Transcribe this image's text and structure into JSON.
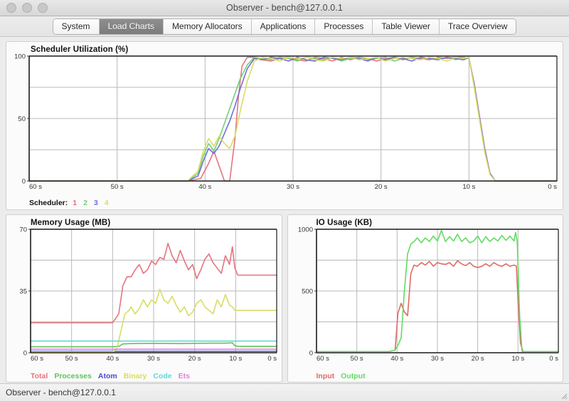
{
  "window": {
    "title": "Observer - bench@127.0.0.1",
    "traffic_lights": [
      "close-button",
      "minimize-button",
      "zoom-button"
    ]
  },
  "tabs": [
    {
      "label": "System",
      "active": false
    },
    {
      "label": "Load Charts",
      "active": true
    },
    {
      "label": "Memory Allocators",
      "active": false
    },
    {
      "label": "Applications",
      "active": false
    },
    {
      "label": "Processes",
      "active": false
    },
    {
      "label": "Table Viewer",
      "active": false
    },
    {
      "label": "Trace Overview",
      "active": false
    }
  ],
  "statusbar": {
    "text": "Observer - bench@127.0.0.1"
  },
  "chart_data": [
    {
      "id": "scheduler",
      "type": "line",
      "title": "Scheduler Utilization (%)",
      "xlabel": "",
      "ylabel": "",
      "ylim": [
        0,
        100
      ],
      "yticks": [
        0,
        50,
        100
      ],
      "ytick_labels": [
        "0",
        "50",
        "100"
      ],
      "xticks": [
        60,
        50,
        40,
        30,
        20,
        10,
        0
      ],
      "xtick_labels": [
        "60 s",
        "50 s",
        "40 s",
        "30 s",
        "20 s",
        "10 s",
        "0 s"
      ],
      "xlim": [
        60,
        0
      ],
      "grid": true,
      "legend_label": "Scheduler:",
      "legend_position": "bottom-left",
      "series": [
        {
          "name": "1",
          "color": "#e8737d",
          "x": [
            60,
            48,
            42,
            40.5,
            39.6,
            39.0,
            38.4,
            37.8,
            37.2,
            36.6,
            36.2,
            35.8,
            35.2,
            34.4,
            33.5,
            32.5,
            31.5,
            30.5,
            29.5,
            28.5,
            27.5,
            26.5,
            25.5,
            24.5,
            23.5,
            22.5,
            21.5,
            20.5,
            19.5,
            18.5,
            17.5,
            16.5,
            15.5,
            14.5,
            13.5,
            12.5,
            11.5,
            10.6,
            10.0,
            9.4,
            8.8,
            8.2,
            7.6,
            7.0,
            4.0,
            0
          ],
          "values": [
            0,
            0,
            0,
            2,
            14,
            24,
            12,
            0,
            0,
            34,
            68,
            92,
            99,
            99,
            97,
            96,
            98,
            99,
            97,
            96,
            99,
            98,
            96,
            99,
            97,
            99,
            98,
            96,
            98,
            99,
            97,
            99,
            98,
            97,
            99,
            98,
            99,
            99,
            98,
            78,
            52,
            26,
            6,
            0,
            0,
            0
          ]
        },
        {
          "name": "2",
          "color": "#74d072",
          "x": [
            60,
            48,
            42,
            40.8,
            40.2,
            39.6,
            39.0,
            38.4,
            37.8,
            37.2,
            36.6,
            36.0,
            35.2,
            34.4,
            33.5,
            32.5,
            31.5,
            30.5,
            29.5,
            28.5,
            27.5,
            26.5,
            25.5,
            24.5,
            23.5,
            22.5,
            21.5,
            20.5,
            19.5,
            18.5,
            17.5,
            16.5,
            15.5,
            14.5,
            13.5,
            12.5,
            11.5,
            10.6,
            10.0,
            9.4,
            8.8,
            8.2,
            7.6,
            7.0,
            4.0,
            0
          ],
          "values": [
            0,
            0,
            0,
            6,
            20,
            30,
            24,
            34,
            46,
            58,
            70,
            82,
            93,
            99,
            98,
            97,
            99,
            98,
            96,
            99,
            98,
            97,
            99,
            96,
            98,
            99,
            97,
            98,
            99,
            96,
            98,
            99,
            97,
            99,
            98,
            99,
            97,
            99,
            98,
            76,
            50,
            24,
            6,
            0,
            0,
            0
          ]
        },
        {
          "name": "3",
          "color": "#6f6fd8",
          "x": [
            60,
            48,
            42,
            40.8,
            40.2,
            39.6,
            39.0,
            38.4,
            37.8,
            37.2,
            36.6,
            36.0,
            35.2,
            34.4,
            33.5,
            32.5,
            31.5,
            30.5,
            29.5,
            28.5,
            27.5,
            26.5,
            25.5,
            24.5,
            23.5,
            22.5,
            21.5,
            20.5,
            19.5,
            18.5,
            17.5,
            16.5,
            15.5,
            14.5,
            13.5,
            12.5,
            11.5,
            10.6,
            10.0,
            9.4,
            8.8,
            8.2,
            7.6,
            7.0,
            4.0,
            0
          ],
          "values": [
            0,
            0,
            0,
            4,
            16,
            26,
            22,
            28,
            38,
            48,
            60,
            74,
            90,
            98,
            97,
            99,
            98,
            96,
            99,
            97,
            96,
            99,
            98,
            97,
            99,
            98,
            96,
            99,
            97,
            99,
            98,
            96,
            99,
            98,
            97,
            99,
            98,
            97,
            99,
            77,
            51,
            25,
            6,
            0,
            0,
            0
          ]
        },
        {
          "name": "4",
          "color": "#d9dc63",
          "x": [
            60,
            48,
            42,
            40.8,
            40.2,
            39.6,
            39.0,
            38.4,
            37.8,
            37.2,
            36.6,
            36.0,
            35.2,
            34.4,
            33.5,
            32.5,
            31.5,
            30.5,
            29.5,
            28.5,
            27.5,
            26.5,
            25.5,
            24.5,
            23.5,
            22.5,
            21.5,
            20.5,
            19.5,
            18.5,
            17.5,
            16.5,
            15.5,
            14.5,
            13.5,
            12.5,
            11.5,
            10.6,
            10.0,
            9.4,
            8.8,
            8.2,
            7.6,
            7.0,
            4.0,
            0
          ],
          "values": [
            0,
            0,
            0,
            8,
            24,
            34,
            28,
            36,
            30,
            26,
            36,
            56,
            80,
            96,
            99,
            98,
            96,
            99,
            98,
            99,
            97,
            96,
            99,
            98,
            99,
            97,
            98,
            99,
            96,
            98,
            99,
            98,
            97,
            99,
            98,
            96,
            99,
            98,
            99,
            75,
            49,
            23,
            5,
            0,
            0,
            0
          ]
        }
      ]
    },
    {
      "id": "memory",
      "type": "line",
      "title": "Memory Usage (MB)",
      "ylim": [
        0,
        70
      ],
      "yticks": [
        0,
        35,
        70
      ],
      "ytick_labels": [
        "0",
        "35",
        "70"
      ],
      "xticks": [
        60,
        50,
        40,
        30,
        20,
        10,
        0
      ],
      "xtick_labels": [
        "60 s",
        "50 s",
        "40 s",
        "30 s",
        "20 s",
        "10 s",
        "0 s"
      ],
      "xlim": [
        60,
        0
      ],
      "grid": true,
      "legend_position": "bottom-left",
      "series": [
        {
          "name": "Total",
          "color": "#e8737d",
          "x": [
            60,
            46,
            40,
            38.5,
            37.5,
            36.5,
            35.5,
            34.5,
            33.5,
            32.5,
            31.5,
            30.5,
            29.5,
            28.5,
            27.5,
            26.5,
            25.5,
            24.5,
            23.5,
            22.5,
            21.5,
            20.5,
            19.5,
            18.5,
            17.5,
            16.5,
            15.5,
            14.5,
            13.5,
            12.5,
            11.5,
            10.8,
            10.2,
            9.5,
            8.5,
            7.5,
            4,
            0
          ],
          "values": [
            17,
            17,
            17,
            22,
            38,
            43,
            43,
            47,
            50,
            45,
            47,
            52,
            50,
            54,
            53,
            62,
            55,
            51,
            58,
            52,
            47,
            50,
            42,
            47,
            53,
            56,
            51,
            48,
            45,
            55,
            50,
            60,
            48,
            44,
            44,
            44,
            44,
            44
          ]
        },
        {
          "name": "Processes",
          "color": "#5ec45c",
          "x": [
            60,
            46,
            40,
            38.5,
            37.5,
            35,
            32,
            28,
            24,
            20,
            16,
            13,
            11.5,
            10.8,
            10.2,
            9.5,
            8,
            4,
            0
          ],
          "values": [
            3.4,
            3.4,
            3.4,
            3.6,
            5.0,
            5.2,
            5.3,
            5.3,
            5.2,
            5.3,
            5.4,
            5.4,
            5.5,
            5.6,
            4.0,
            3.6,
            3.6,
            3.6,
            3.6
          ]
        },
        {
          "name": "Atom",
          "color": "#4a4ad0",
          "x": [
            60,
            40,
            20,
            0
          ],
          "values": [
            0.8,
            0.8,
            0.8,
            0.8
          ]
        },
        {
          "name": "Binary",
          "color": "#d9dc63",
          "x": [
            60,
            46,
            40,
            39,
            38,
            37,
            36,
            35.5,
            34.5,
            33.5,
            32.5,
            31.5,
            30.5,
            29.5,
            28.5,
            27.5,
            26.5,
            25.5,
            24.5,
            23.5,
            22.5,
            21.5,
            20.5,
            19.5,
            18.5,
            17.5,
            16.5,
            15.5,
            14.5,
            13.5,
            12.5,
            11.5,
            10.8,
            10.2,
            9.5,
            8.5,
            4,
            0
          ],
          "values": [
            0.5,
            0.5,
            0.5,
            2,
            12,
            22,
            24,
            26,
            22,
            25,
            30,
            26,
            30,
            28,
            36,
            30,
            28,
            32,
            27,
            23,
            26,
            21,
            23,
            28,
            30,
            26,
            24,
            22,
            30,
            26,
            33,
            27,
            26,
            24,
            24,
            24,
            24,
            24
          ]
        },
        {
          "name": "Code",
          "color": "#5fd8d8",
          "x": [
            60,
            40,
            20,
            0
          ],
          "values": [
            6.6,
            6.6,
            6.6,
            6.6
          ]
        },
        {
          "name": "Ets",
          "color": "#e57ce0",
          "x": [
            60,
            40,
            20,
            0
          ],
          "values": [
            2.0,
            2.0,
            2.0,
            2.0
          ]
        }
      ]
    },
    {
      "id": "io",
      "type": "line",
      "title": "IO Usage (KB)",
      "ylim": [
        0,
        1000
      ],
      "yticks": [
        0,
        500,
        1000
      ],
      "ytick_labels": [
        "0",
        "500",
        "1000"
      ],
      "xticks": [
        60,
        50,
        40,
        30,
        20,
        10,
        0
      ],
      "xtick_labels": [
        "60 s",
        "50 s",
        "40 s",
        "30 s",
        "20 s",
        "10 s",
        "0 s"
      ],
      "xlim": [
        60,
        0
      ],
      "grid": true,
      "legend_position": "bottom-left",
      "series": [
        {
          "name": "Input",
          "color": "#e06a63",
          "x": [
            60,
            42,
            40.5,
            39.8,
            39.0,
            38.2,
            37.4,
            36.6,
            35.8,
            35.0,
            34.0,
            33.0,
            32.0,
            31.0,
            30.0,
            29.0,
            28.0,
            27.0,
            26.0,
            25.0,
            24.0,
            23.0,
            22.0,
            21.0,
            20.0,
            19.0,
            18.0,
            17.0,
            16.0,
            15.0,
            14.0,
            13.0,
            12.0,
            11.0,
            10.4,
            10.0,
            9.4,
            8.8,
            4,
            0
          ],
          "values": [
            10,
            10,
            20,
            320,
            400,
            330,
            300,
            640,
            710,
            700,
            730,
            710,
            740,
            700,
            730,
            720,
            715,
            730,
            700,
            745,
            720,
            705,
            730,
            700,
            690,
            700,
            720,
            700,
            730,
            710,
            700,
            720,
            700,
            710,
            700,
            420,
            80,
            10,
            10,
            10
          ]
        },
        {
          "name": "Output",
          "color": "#5fdd5f",
          "x": [
            60,
            42,
            40.5,
            39.8,
            39.0,
            38.2,
            37.4,
            36.6,
            35.8,
            35.0,
            34.0,
            33.0,
            32.0,
            31.0,
            30.0,
            29.0,
            28.0,
            27.0,
            26.0,
            25.0,
            24.0,
            23.0,
            22.0,
            21.0,
            20.0,
            19.0,
            18.0,
            17.0,
            16.0,
            15.0,
            14.0,
            13.0,
            12.0,
            11.0,
            10.6,
            10.2,
            9.6,
            9.0,
            4,
            0
          ],
          "values": [
            10,
            10,
            20,
            60,
            120,
            500,
            800,
            880,
            900,
            930,
            890,
            930,
            900,
            945,
            905,
            990,
            900,
            940,
            905,
            960,
            900,
            930,
            890,
            905,
            945,
            890,
            940,
            900,
            930,
            905,
            950,
            910,
            945,
            905,
            975,
            900,
            300,
            10,
            10,
            10
          ]
        }
      ]
    }
  ]
}
